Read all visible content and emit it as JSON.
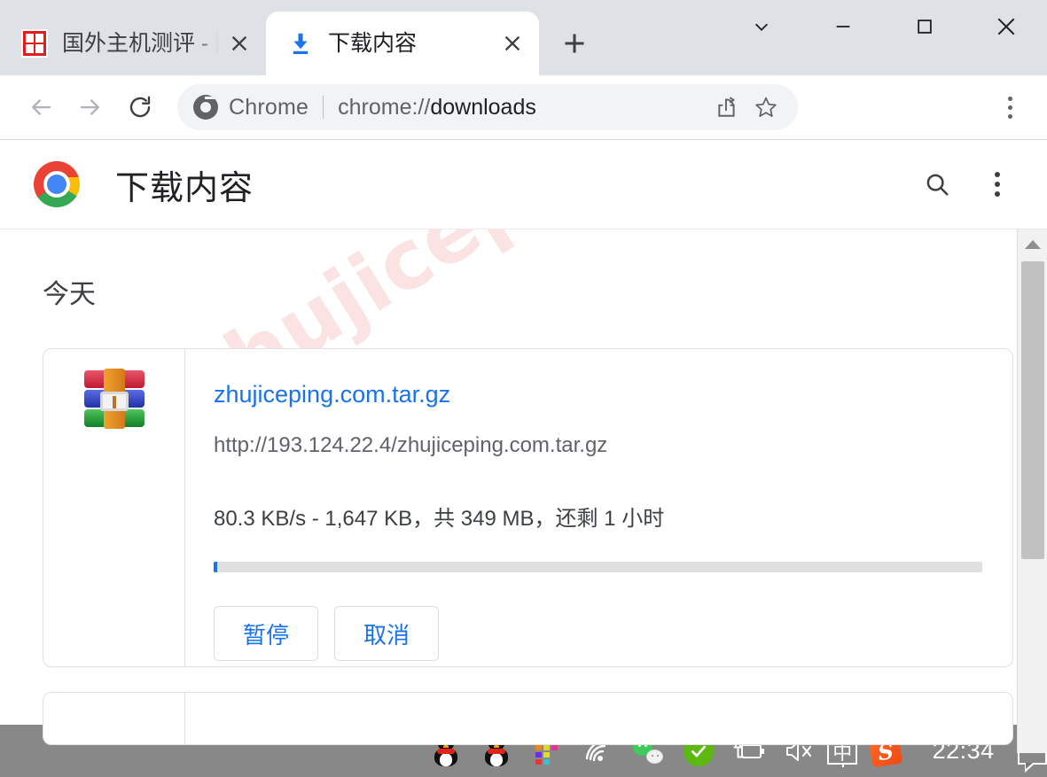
{
  "browser": {
    "tabs": [
      {
        "title": "国外主机测评 - 国",
        "favicon": "stamp-favicon",
        "active": false
      },
      {
        "title": "下载内容",
        "favicon": "download-icon",
        "active": true
      }
    ],
    "new_tab_label": "+",
    "window_controls": [
      {
        "name": "tab-search",
        "glyph": "chevron-down"
      },
      {
        "name": "minimize",
        "glyph": "minus"
      },
      {
        "name": "maximize",
        "glyph": "square"
      },
      {
        "name": "close",
        "glyph": "x"
      }
    ],
    "nav": {
      "back": "back-arrow",
      "forward": "forward-arrow",
      "reload": "reload-arrow"
    },
    "omnibox": {
      "badge": "Chrome",
      "url_scheme": "chrome://",
      "url_path": "downloads",
      "url_full": "chrome://downloads",
      "share_icon": "share-icon",
      "bookmark_icon": "star-icon"
    },
    "menu_icon": "three-dots-vertical"
  },
  "downloads_page": {
    "logo": "chrome-logo",
    "title": "下载内容",
    "search_icon": "search-icon",
    "more_icon": "three-dots-vertical",
    "section_label": "今天",
    "watermark": "zhujiceping.com",
    "items": [
      {
        "file_icon": "winrar-archive-icon",
        "filename": "zhujiceping.com.tar.gz",
        "url": "http://193.124.22.4/zhujiceping.com.tar.gz",
        "status": "80.3 KB/s - 1,647 KB，共 349 MB，还剩 1 小时",
        "speed": "80.3 KB/s",
        "downloaded": "1,647 KB",
        "total_size": "349 MB",
        "time_remaining": "还剩 1 小时",
        "progress_percent": 0.5,
        "buttons": [
          {
            "label": "暂停",
            "name": "pause-button"
          },
          {
            "label": "取消",
            "name": "cancel-button"
          }
        ]
      }
    ]
  },
  "colors": {
    "link": "#1a73e8",
    "tabstrip_bg": "#dee1e6",
    "progress_fill": "#1a73e8",
    "progress_track": "#e0e0e0",
    "watermark": "#fbe3e3"
  },
  "taskbar": {
    "icons": [
      {
        "name": "qq-penguin-icon-1",
        "type": "penguin"
      },
      {
        "name": "qq-penguin-icon-2",
        "type": "penguin"
      },
      {
        "name": "color-grid-icon",
        "type": "grid"
      },
      {
        "name": "wifi-icon",
        "type": "wifi"
      },
      {
        "name": "wechat-icon",
        "type": "wechat"
      },
      {
        "name": "security-shield-icon",
        "type": "shield"
      },
      {
        "name": "battery-charging-icon",
        "type": "battery"
      },
      {
        "name": "volume-mute-icon",
        "type": "mute"
      }
    ],
    "ime_label": "中",
    "sogou_label": "S",
    "clock": "22:34",
    "notification_icon": "notification-bubble-icon"
  }
}
